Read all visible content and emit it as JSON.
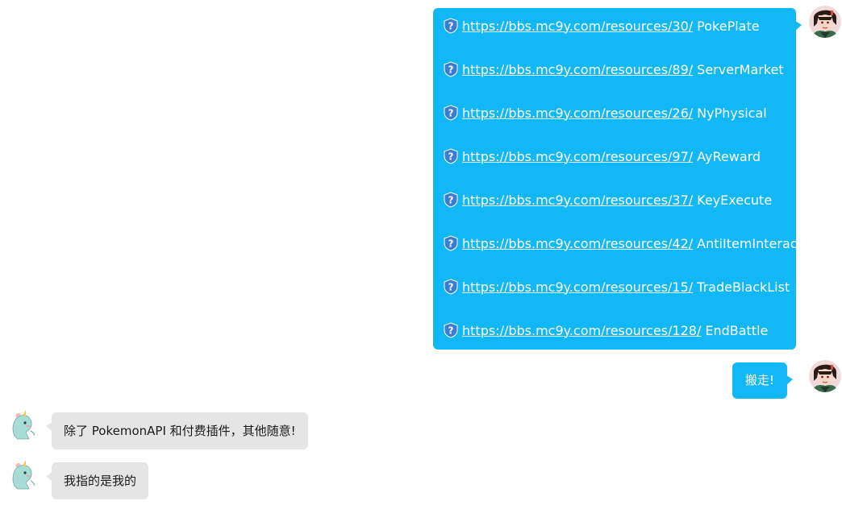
{
  "conversation": {
    "messages": [
      {
        "sender": "me",
        "type": "link_list",
        "links": [
          {
            "url": "https://bbs.mc9y.com/resources/30/",
            "name": "PokePlate"
          },
          {
            "url": "https://bbs.mc9y.com/resources/89/",
            "name": "ServerMarket"
          },
          {
            "url": "https://bbs.mc9y.com/resources/26/",
            "name": "NyPhysical"
          },
          {
            "url": "https://bbs.mc9y.com/resources/97/",
            "name": "AyReward"
          },
          {
            "url": "https://bbs.mc9y.com/resources/37/",
            "name": "KeyExecute"
          },
          {
            "url": "https://bbs.mc9y.com/resources/42/",
            "name": "AntiItemInteract"
          },
          {
            "url": "https://bbs.mc9y.com/resources/15/",
            "name": "TradeBlackList"
          },
          {
            "url": "https://bbs.mc9y.com/resources/128/",
            "name": "EndBattle"
          }
        ]
      },
      {
        "sender": "me",
        "type": "text",
        "text": "搬走!"
      },
      {
        "sender": "other",
        "type": "text",
        "text": "除了 PokemonAPI 和付费插件，其他随意!"
      },
      {
        "sender": "other",
        "type": "text",
        "text": "我指的是我的"
      }
    ]
  },
  "colors": {
    "outgoing_bubble": "#12b7f5",
    "incoming_bubble": "#e5e5e5",
    "link_icon": "#3a7bd5"
  },
  "icons": {
    "link_status": "question-shield-icon",
    "my_avatar": "anime-character-avatar",
    "other_avatar": "unicorn-avatar"
  }
}
